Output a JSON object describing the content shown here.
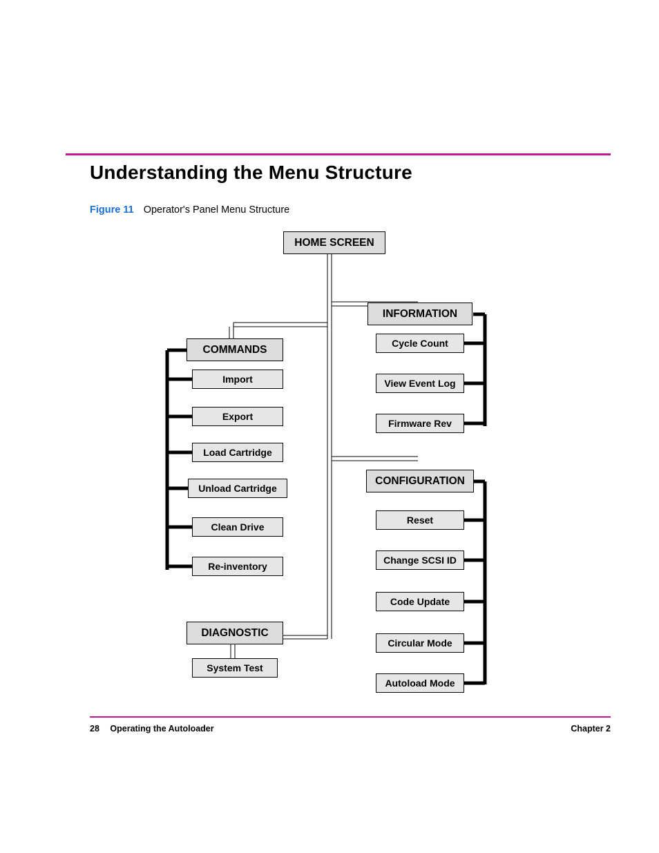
{
  "heading": "Understanding the Menu Structure",
  "figure": {
    "label": "Figure 11",
    "caption": "Operator's Panel Menu Structure"
  },
  "menu": {
    "root": "HOME SCREEN",
    "commands": {
      "title": "COMMANDS",
      "items": [
        "Import",
        "Export",
        "Load Cartridge",
        "Unload Cartridge",
        "Clean Drive",
        "Re-inventory"
      ]
    },
    "information": {
      "title": "INFORMATION",
      "items": [
        "Cycle Count",
        "View Event Log",
        "Firmware Rev"
      ]
    },
    "configuration": {
      "title": "CONFIGURATION",
      "items": [
        "Reset",
        "Change SCSI ID",
        "Code Update",
        "Circular Mode",
        "Autoload Mode"
      ]
    },
    "diagnostic": {
      "title": "DIAGNOSTIC",
      "items": [
        "System Test"
      ]
    }
  },
  "footer": {
    "page": "28",
    "section": "Operating the Autoloader",
    "chapter": "Chapter 2"
  },
  "colors": {
    "accent": "#c6168d",
    "link": "#1a6fd6"
  }
}
